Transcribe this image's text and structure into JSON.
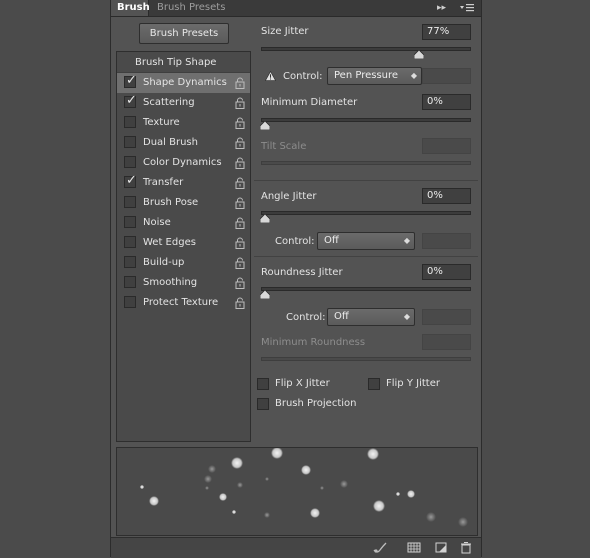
{
  "tabs": {
    "active": "Brush",
    "inactive": "Brush Presets"
  },
  "panel_controls": {
    "collapse_glyph": "▸▸",
    "menu_glyph": "☰"
  },
  "presets_button": "Brush Presets",
  "list": {
    "title": "Brush Tip Shape",
    "items": [
      {
        "label": "Shape Dynamics",
        "checked": true,
        "selected": true
      },
      {
        "label": "Scattering",
        "checked": true
      },
      {
        "label": "Texture",
        "checked": false
      },
      {
        "label": "Dual Brush",
        "checked": false
      },
      {
        "label": "Color Dynamics",
        "checked": false
      },
      {
        "label": "Transfer",
        "checked": true
      },
      {
        "label": "Brush Pose",
        "checked": false
      },
      {
        "label": "Noise",
        "checked": false
      },
      {
        "label": "Wet Edges",
        "checked": false
      },
      {
        "label": "Build-up",
        "checked": false
      },
      {
        "label": "Smoothing",
        "checked": false
      },
      {
        "label": "Protect Texture",
        "checked": false
      }
    ]
  },
  "settings": {
    "size_jitter": {
      "label": "Size Jitter",
      "value": "77%",
      "fraction": 0.77
    },
    "size_control": {
      "label": "Control:",
      "value": "Pen Pressure",
      "warning_icon": "warning-icon"
    },
    "minimum_diameter": {
      "label": "Minimum Diameter",
      "value": "0%",
      "fraction": 0
    },
    "tilt_scale": {
      "label": "Tilt Scale"
    },
    "angle_jitter": {
      "label": "Angle Jitter",
      "value": "0%",
      "fraction": 0
    },
    "angle_control": {
      "label": "Control:",
      "value": "Off"
    },
    "roundness_jitter": {
      "label": "Roundness Jitter",
      "value": "0%",
      "fraction": 0
    },
    "roundness_control": {
      "label": "Control:",
      "value": "Off"
    },
    "minimum_roundness": {
      "label": "Minimum Roundness"
    },
    "flip_x": {
      "label": "Flip X Jitter",
      "checked": false
    },
    "flip_y": {
      "label": "Flip Y Jitter",
      "checked": false
    },
    "brush_projection": {
      "label": "Brush Projection",
      "checked": false
    }
  },
  "bottom_icons": [
    "brush-toggle-icon",
    "grid-icon",
    "new-preset-icon",
    "trash-icon"
  ],
  "colors": {
    "panel": "#535353",
    "selected_row": "#6f6f6f",
    "field_bg": "#404040"
  }
}
